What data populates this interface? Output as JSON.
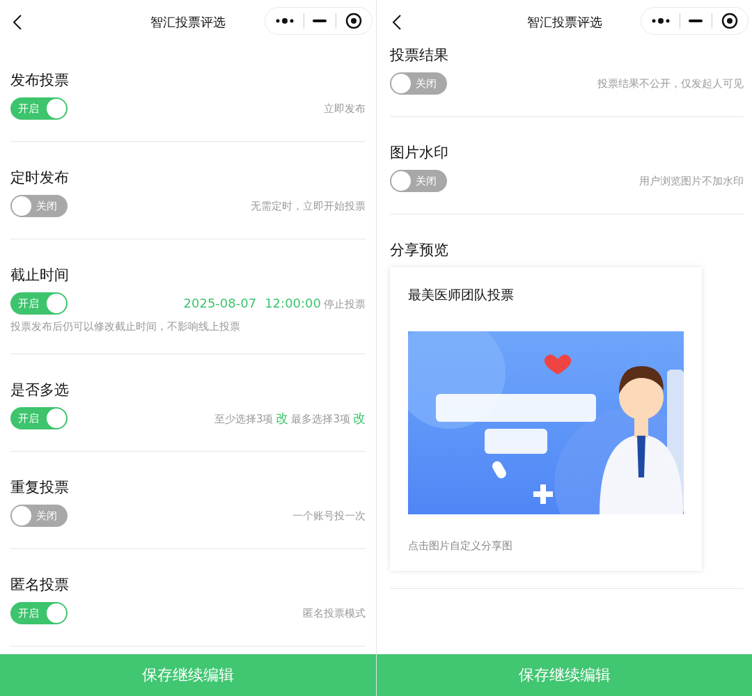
{
  "screens": [
    {
      "title": "智汇投票评选",
      "settings": [
        {
          "kind": "plain",
          "label": "发布投票",
          "toggle": {
            "on": true,
            "text": "开启"
          },
          "hint": "立即发布"
        },
        {
          "kind": "plain",
          "label": "定时发布",
          "toggle": {
            "on": false,
            "text": "关闭"
          },
          "hint": "无需定时，立即开始投票"
        },
        {
          "kind": "deadline",
          "label": "截止时间",
          "toggle": {
            "on": true,
            "text": "开启"
          },
          "date": "2025-08-07",
          "time": "12:00:00",
          "suffix": "停止投票",
          "note": "投票发布后仍可以修改截止时间，不影响线上投票"
        },
        {
          "kind": "multi",
          "label": "是否多选",
          "toggle": {
            "on": true,
            "text": "开启"
          },
          "min_text": "至少选择3项",
          "min_action": "改",
          "max_text": "最多选择3项",
          "max_action": "改"
        },
        {
          "kind": "plain",
          "label": "重复投票",
          "toggle": {
            "on": false,
            "text": "关闭"
          },
          "hint": "一个账号投一次"
        },
        {
          "kind": "plain",
          "label": "匿名投票",
          "toggle": {
            "on": true,
            "text": "开启"
          },
          "hint": "匿名投票模式"
        }
      ],
      "button": "保存继续编辑"
    },
    {
      "title": "智汇投票评选",
      "settings": [
        {
          "kind": "plain",
          "label": "投票结果",
          "toggle": {
            "on": false,
            "text": "关闭"
          },
          "hint": "投票结果不公开，仅发起人可见"
        },
        {
          "kind": "plain",
          "label": "图片水印",
          "toggle": {
            "on": false,
            "text": "关闭"
          },
          "hint": "用户浏览图片不加水印"
        }
      ],
      "share_preview": {
        "heading": "分享预览",
        "card_title": "最美医师团队投票",
        "caption": "点击图片自定义分享图"
      },
      "button": "保存继续编辑"
    }
  ]
}
